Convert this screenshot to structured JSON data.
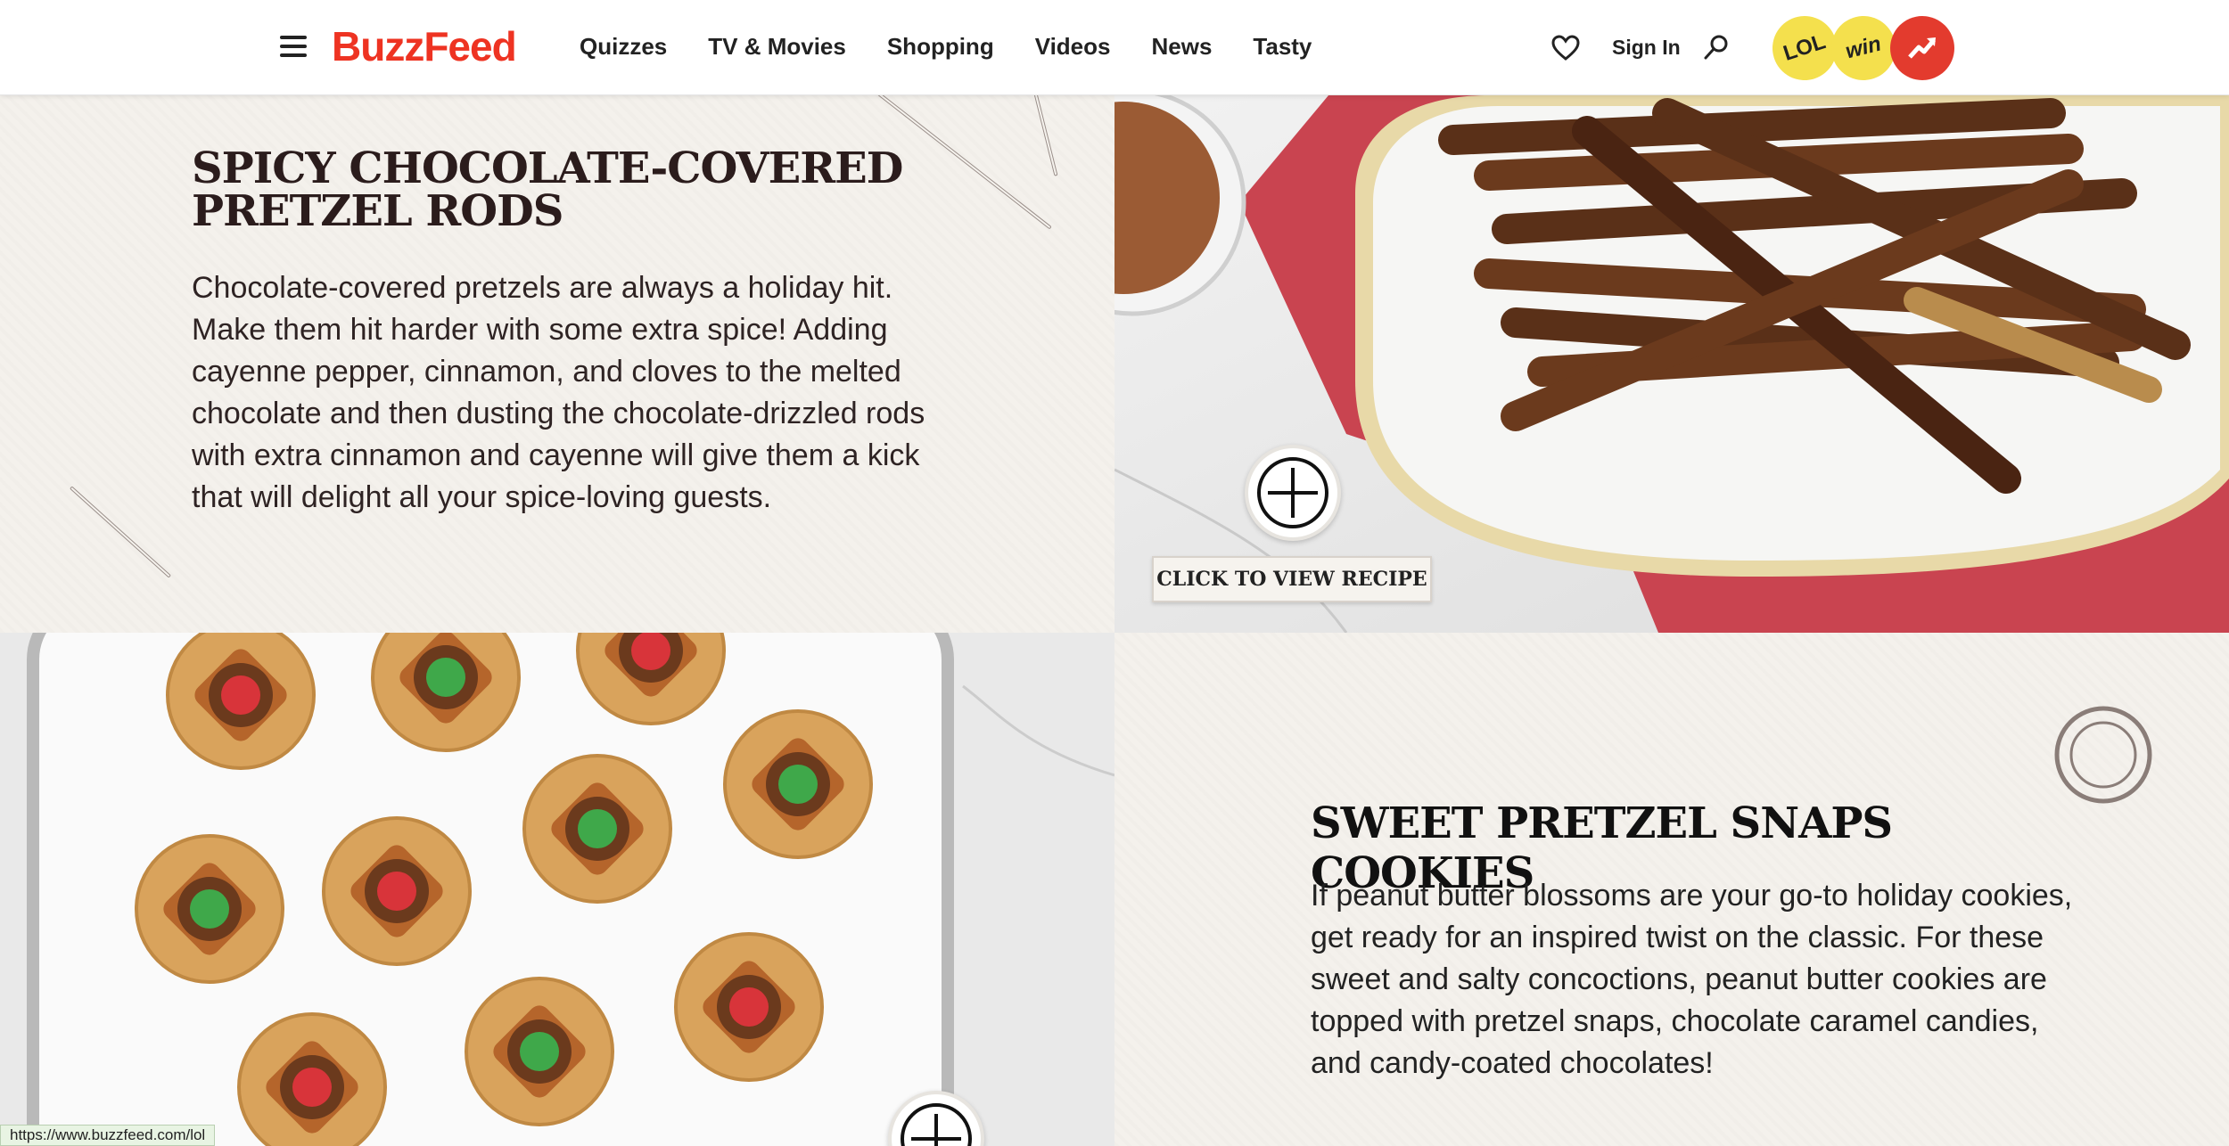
{
  "nav": {
    "logo": "BuzzFeed",
    "links": [
      "Quizzes",
      "TV & Movies",
      "Shopping",
      "Videos",
      "News",
      "Tasty"
    ],
    "sign_in": "Sign In",
    "badges": {
      "lol": "LOL",
      "win": "win"
    },
    "icons": [
      "hamburger-menu-icon",
      "heart-icon",
      "search-icon",
      "trending-icon"
    ]
  },
  "recipes": [
    {
      "title": "SPICY CHOCOLATE-COVERED PRETZEL RODS",
      "description": "Chocolate-covered pretzels are always a holiday hit. Make them hit harder with some extra spice! Adding cayenne pepper, cinnamon, and cloves to the melted chocolate and then dusting the chocolate-drizzled rods with extra cinnamon and cayenne will give them a kick that will delight all your spice-loving guests.",
      "button": "CLICK TO VIEW RECIPE"
    },
    {
      "title": "SWEET PRETZEL SNAPS COOKIES",
      "description": "If peanut butter blossoms are your go-to holiday cookies, get ready for an inspired twist on the classic. For these sweet and salty concoctions, peanut butter cookies are topped with pretzel snaps, chocolate caramel candies, and candy-coated chocolates!"
    }
  ],
  "status_url": "https://www.buzzfeed.com/lol",
  "colors": {
    "brand": "#ee3322",
    "badge_yellow": "#f4e04d",
    "trend_red": "#e33b2e",
    "panel_bg": "#f4f1ec"
  }
}
